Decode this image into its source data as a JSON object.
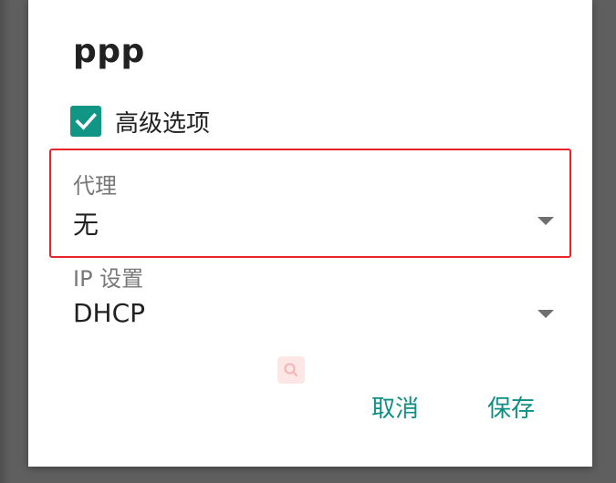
{
  "dialog": {
    "title": "ppp",
    "advanced_checkbox": {
      "label": "高级选项",
      "checked": true,
      "color": "#119686"
    },
    "proxy": {
      "label": "代理",
      "value": "无"
    },
    "ip_settings": {
      "label": "IP 设置",
      "value": "DHCP"
    },
    "actions": {
      "cancel": "取消",
      "save": "保存"
    },
    "accent_color": "#0f8f83",
    "highlight_color": "#e8232c"
  }
}
